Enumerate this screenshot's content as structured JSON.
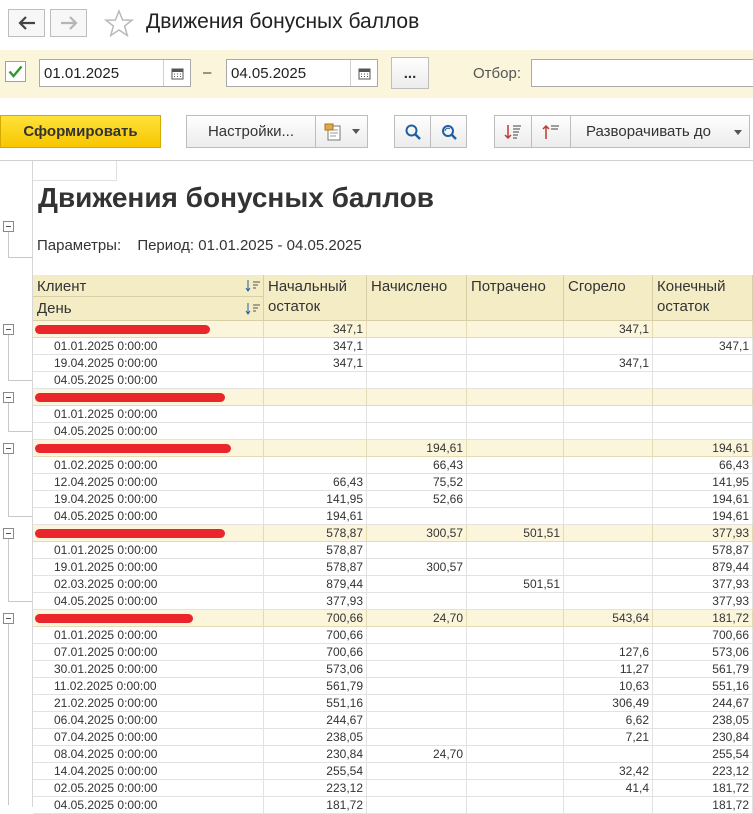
{
  "window": {
    "title": "Движения бонусных баллов"
  },
  "period": {
    "enabled": true,
    "from": "01.01.2025",
    "separator": "–",
    "to": "04.05.2025",
    "more_label": "...",
    "filter_label": "Отбор:",
    "filter_value": ""
  },
  "toolbar": {
    "generate_label": "Сформировать",
    "settings_label": "Настройки...",
    "expand_label": "Разворачивать до"
  },
  "report": {
    "title": "Движения бонусных баллов",
    "params_label": "Параметры:",
    "params_value": "Период: 01.01.2025 - 04.05.2025",
    "header": {
      "client": "Клиент",
      "day": "День",
      "start1": "Начальный",
      "start2": "остаток",
      "accrued": "Начислено",
      "spent": "Потрачено",
      "burned": "Сгорело",
      "end1": "Конечный",
      "end2": "остаток"
    },
    "rows": [
      {
        "g": true,
        "label": "",
        "w": 175,
        "c": [
          "347,1",
          "",
          "",
          "347,1",
          ""
        ]
      },
      {
        "g": false,
        "label": "01.01.2025 0:00:00",
        "c": [
          "347,1",
          "",
          "",
          "",
          "347,1"
        ]
      },
      {
        "g": false,
        "label": "19.04.2025 0:00:00",
        "c": [
          "347,1",
          "",
          "",
          "347,1",
          ""
        ]
      },
      {
        "g": false,
        "label": "04.05.2025 0:00:00",
        "c": [
          "",
          "",
          "",
          "",
          ""
        ]
      },
      {
        "g": true,
        "label": "",
        "w": 190,
        "c": [
          "",
          "",
          "",
          "",
          ""
        ]
      },
      {
        "g": false,
        "label": "01.01.2025 0:00:00",
        "c": [
          "",
          "",
          "",
          "",
          ""
        ]
      },
      {
        "g": false,
        "label": "04.05.2025 0:00:00",
        "c": [
          "",
          "",
          "",
          "",
          ""
        ]
      },
      {
        "g": true,
        "label": "",
        "w": 196,
        "c": [
          "",
          "194,61",
          "",
          "",
          "194,61"
        ]
      },
      {
        "g": false,
        "label": "01.02.2025 0:00:00",
        "c": [
          "",
          "66,43",
          "",
          "",
          "66,43"
        ]
      },
      {
        "g": false,
        "label": "12.04.2025 0:00:00",
        "c": [
          "66,43",
          "75,52",
          "",
          "",
          "141,95"
        ]
      },
      {
        "g": false,
        "label": "19.04.2025 0:00:00",
        "c": [
          "141,95",
          "52,66",
          "",
          "",
          "194,61"
        ]
      },
      {
        "g": false,
        "label": "04.05.2025 0:00:00",
        "c": [
          "194,61",
          "",
          "",
          "",
          "194,61"
        ]
      },
      {
        "g": true,
        "label": "",
        "w": 190,
        "c": [
          "578,87",
          "300,57",
          "501,51",
          "",
          "377,93"
        ]
      },
      {
        "g": false,
        "label": "01.01.2025 0:00:00",
        "c": [
          "578,87",
          "",
          "",
          "",
          "578,87"
        ]
      },
      {
        "g": false,
        "label": "19.01.2025 0:00:00",
        "c": [
          "578,87",
          "300,57",
          "",
          "",
          "879,44"
        ]
      },
      {
        "g": false,
        "label": "02.03.2025 0:00:00",
        "c": [
          "879,44",
          "",
          "501,51",
          "",
          "377,93"
        ]
      },
      {
        "g": false,
        "label": "04.05.2025 0:00:00",
        "c": [
          "377,93",
          "",
          "",
          "",
          "377,93"
        ]
      },
      {
        "g": true,
        "label": "",
        "w": 158,
        "c": [
          "700,66",
          "24,70",
          "",
          "543,64",
          "181,72"
        ]
      },
      {
        "g": false,
        "label": "01.01.2025 0:00:00",
        "c": [
          "700,66",
          "",
          "",
          "",
          "700,66"
        ]
      },
      {
        "g": false,
        "label": "07.01.2025 0:00:00",
        "c": [
          "700,66",
          "",
          "",
          "127,6",
          "573,06"
        ]
      },
      {
        "g": false,
        "label": "30.01.2025 0:00:00",
        "c": [
          "573,06",
          "",
          "",
          "11,27",
          "561,79"
        ]
      },
      {
        "g": false,
        "label": "11.02.2025 0:00:00",
        "c": [
          "561,79",
          "",
          "",
          "10,63",
          "551,16"
        ]
      },
      {
        "g": false,
        "label": "21.02.2025 0:00:00",
        "c": [
          "551,16",
          "",
          "",
          "306,49",
          "244,67"
        ]
      },
      {
        "g": false,
        "label": "06.04.2025 0:00:00",
        "c": [
          "244,67",
          "",
          "",
          "6,62",
          "238,05"
        ]
      },
      {
        "g": false,
        "label": "07.04.2025 0:00:00",
        "c": [
          "238,05",
          "",
          "",
          "7,21",
          "230,84"
        ]
      },
      {
        "g": false,
        "label": "08.04.2025 0:00:00",
        "c": [
          "230,84",
          "24,70",
          "",
          "",
          "255,54"
        ]
      },
      {
        "g": false,
        "label": "14.04.2025 0:00:00",
        "c": [
          "255,54",
          "",
          "",
          "32,42",
          "223,12"
        ]
      },
      {
        "g": false,
        "label": "02.05.2025 0:00:00",
        "c": [
          "223,12",
          "",
          "",
          "41,4",
          "181,72"
        ]
      },
      {
        "g": false,
        "label": "04.05.2025 0:00:00",
        "c": [
          "181,72",
          "",
          "",
          "",
          "181,72"
        ]
      }
    ]
  }
}
